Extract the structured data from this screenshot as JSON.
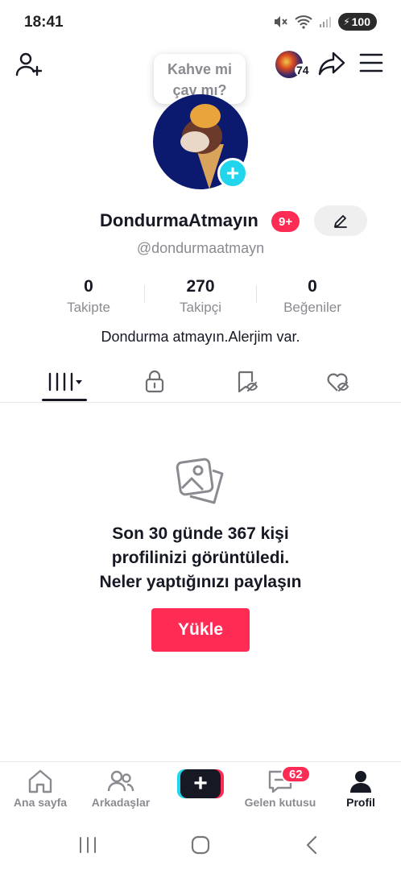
{
  "status_bar": {
    "time": "18:41",
    "battery": "100"
  },
  "header": {
    "tooltip_line1": "Kahve mi",
    "tooltip_line2": "çay mı?",
    "story_count": "74"
  },
  "profile": {
    "username": "DondurmaAtmayın",
    "notification_badge": "9+",
    "handle": "@dondurmaatmayn",
    "bio": "Dondurma atmayın.Alerjim var."
  },
  "stats": [
    {
      "value": "0",
      "label": "Takipte"
    },
    {
      "value": "270",
      "label": "Takipçi"
    },
    {
      "value": "0",
      "label": "Beğeniler"
    }
  ],
  "empty_state": {
    "line1": "Son 30 günde 367 kişi",
    "line2": "profilinizi görüntüledi.",
    "line3": "Neler yaptığınızı paylaşın",
    "button": "Yükle"
  },
  "bottom_nav": {
    "home": "Ana sayfa",
    "friends": "Arkadaşlar",
    "inbox": "Gelen kutusu",
    "inbox_badge": "62",
    "profile": "Profil"
  },
  "colors": {
    "accent": "#fe2c55",
    "cyan": "#20d5ec",
    "text": "#161823",
    "muted": "#8a8b91"
  }
}
